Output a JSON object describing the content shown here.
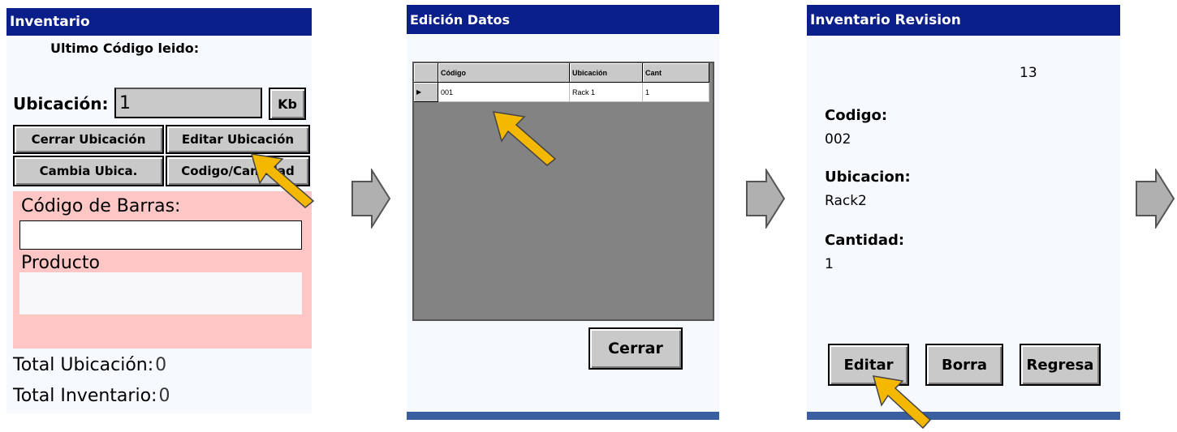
{
  "screen1": {
    "title": "Inventario",
    "last_code_label": "Ultimo Código leido:",
    "location_label": "Ubicación:",
    "location_value": "1",
    "kb_button": "Kb",
    "close_location_button": "Cerrar Ubicación",
    "edit_location_button": "Editar Ubicación",
    "change_location_button": "Cambia Ubica.",
    "code_quantity_button": "Codigo/Cantidad",
    "barcode_label": "Código de Barras:",
    "barcode_value": "",
    "product_label": "Producto",
    "product_value": "",
    "total_location_label": "Total Ubicación:",
    "total_location_value": "0",
    "total_inventory_label": "Total Inventario:",
    "total_inventory_value": "0"
  },
  "screen2": {
    "title": "Edición Datos",
    "grid": {
      "columns": [
        "Código",
        "Ubicación",
        "Cant"
      ],
      "rows": [
        {
          "indicator": "▶",
          "cells": [
            "001",
            "Rack 1",
            "1"
          ]
        }
      ]
    },
    "close_button": "Cerrar"
  },
  "screen3": {
    "title": "Inventario Revision",
    "count": "13",
    "code_label": "Codigo:",
    "code_value": "002",
    "location_label": "Ubicacion:",
    "location_value": "Rack2",
    "quantity_label": "Cantidad:",
    "quantity_value": "1",
    "edit_button": "Editar",
    "delete_button": "Borra",
    "return_button": "Regresa"
  },
  "colors": {
    "titlebar": "#0b1f8a",
    "barcode_panel": "#ffc6c6",
    "button_face": "#c9c9c9",
    "grid_background": "#838383",
    "cursor_fill": "#f5b800"
  }
}
